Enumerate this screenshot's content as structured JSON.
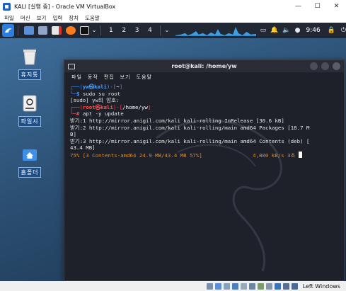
{
  "window": {
    "title": "KALI [실행 중] - Oracle VM VirtualBox",
    "minimize": "—",
    "maximize": "☐",
    "close": "✕"
  },
  "menubar": {
    "items": [
      "파일",
      "머신",
      "보기",
      "입력",
      "장치",
      "도움말"
    ]
  },
  "taskbar": {
    "workspaces": [
      "1",
      "2",
      "3",
      "4"
    ],
    "clock": "9:46"
  },
  "desktop": {
    "icons": [
      {
        "name": "trash",
        "label": "휴지통"
      },
      {
        "name": "filesystem",
        "label": "파일시"
      },
      {
        "name": "home",
        "label": "홈폴더"
      }
    ]
  },
  "terminal": {
    "title": "root@kali: /home/yw",
    "menu": [
      "파일",
      "동작",
      "편집",
      "보기",
      "도움말"
    ],
    "lines": [
      {
        "segs": [
          {
            "t": "┌──(",
            "c": "c-blue"
          },
          {
            "t": "yw㉿kali",
            "c": "c-bluebold"
          },
          {
            "t": ")-[",
            "c": "c-blue"
          },
          {
            "t": "~",
            "c": "c-white"
          },
          {
            "t": "]",
            "c": "c-blue"
          }
        ]
      },
      {
        "segs": [
          {
            "t": "└─",
            "c": "c-blue"
          },
          {
            "t": "$ ",
            "c": "c-bluebold"
          },
          {
            "t": "sudo su root",
            "c": ""
          }
        ]
      },
      {
        "segs": [
          {
            "t": "[sudo] yw의 암호: ",
            "c": ""
          }
        ]
      },
      {
        "segs": [
          {
            "t": "┌──(",
            "c": "c-red"
          },
          {
            "t": "root㉿kali",
            "c": "c-redbold"
          },
          {
            "t": ")-[",
            "c": "c-red"
          },
          {
            "t": "/home/yw",
            "c": "c-white"
          },
          {
            "t": "]",
            "c": "c-red"
          }
        ]
      },
      {
        "segs": [
          {
            "t": "└─",
            "c": "c-red"
          },
          {
            "t": "# ",
            "c": "c-redbold"
          },
          {
            "t": "apt -y update",
            "c": ""
          }
        ]
      },
      {
        "segs": [
          {
            "t": "받기:1 http://mirror.anigil.com/kali kali-rolling InRelease [30.6 kB]",
            "c": ""
          }
        ]
      },
      {
        "segs": [
          {
            "t": "받기:2 http://mirror.anigil.com/kali kali-rolling/main amd64 Packages [18.7 M",
            "c": ""
          }
        ]
      },
      {
        "segs": [
          {
            "t": "B]",
            "c": ""
          }
        ]
      },
      {
        "segs": [
          {
            "t": "받기:3 http://mirror.anigil.com/kali kali-rolling/main amd64 Contents (deb) [",
            "c": ""
          }
        ]
      },
      {
        "segs": [
          {
            "t": "43.4 MB]",
            "c": ""
          }
        ]
      },
      {
        "segs": [
          {
            "t": "75% [3 Contents-amd64 24.9 MB/43.4 MB 57%]                4,800 kB/s 3초",
            "c": "c-orange"
          }
        ],
        "cursor": true
      }
    ]
  },
  "status": {
    "host_key": "Left Windows"
  }
}
